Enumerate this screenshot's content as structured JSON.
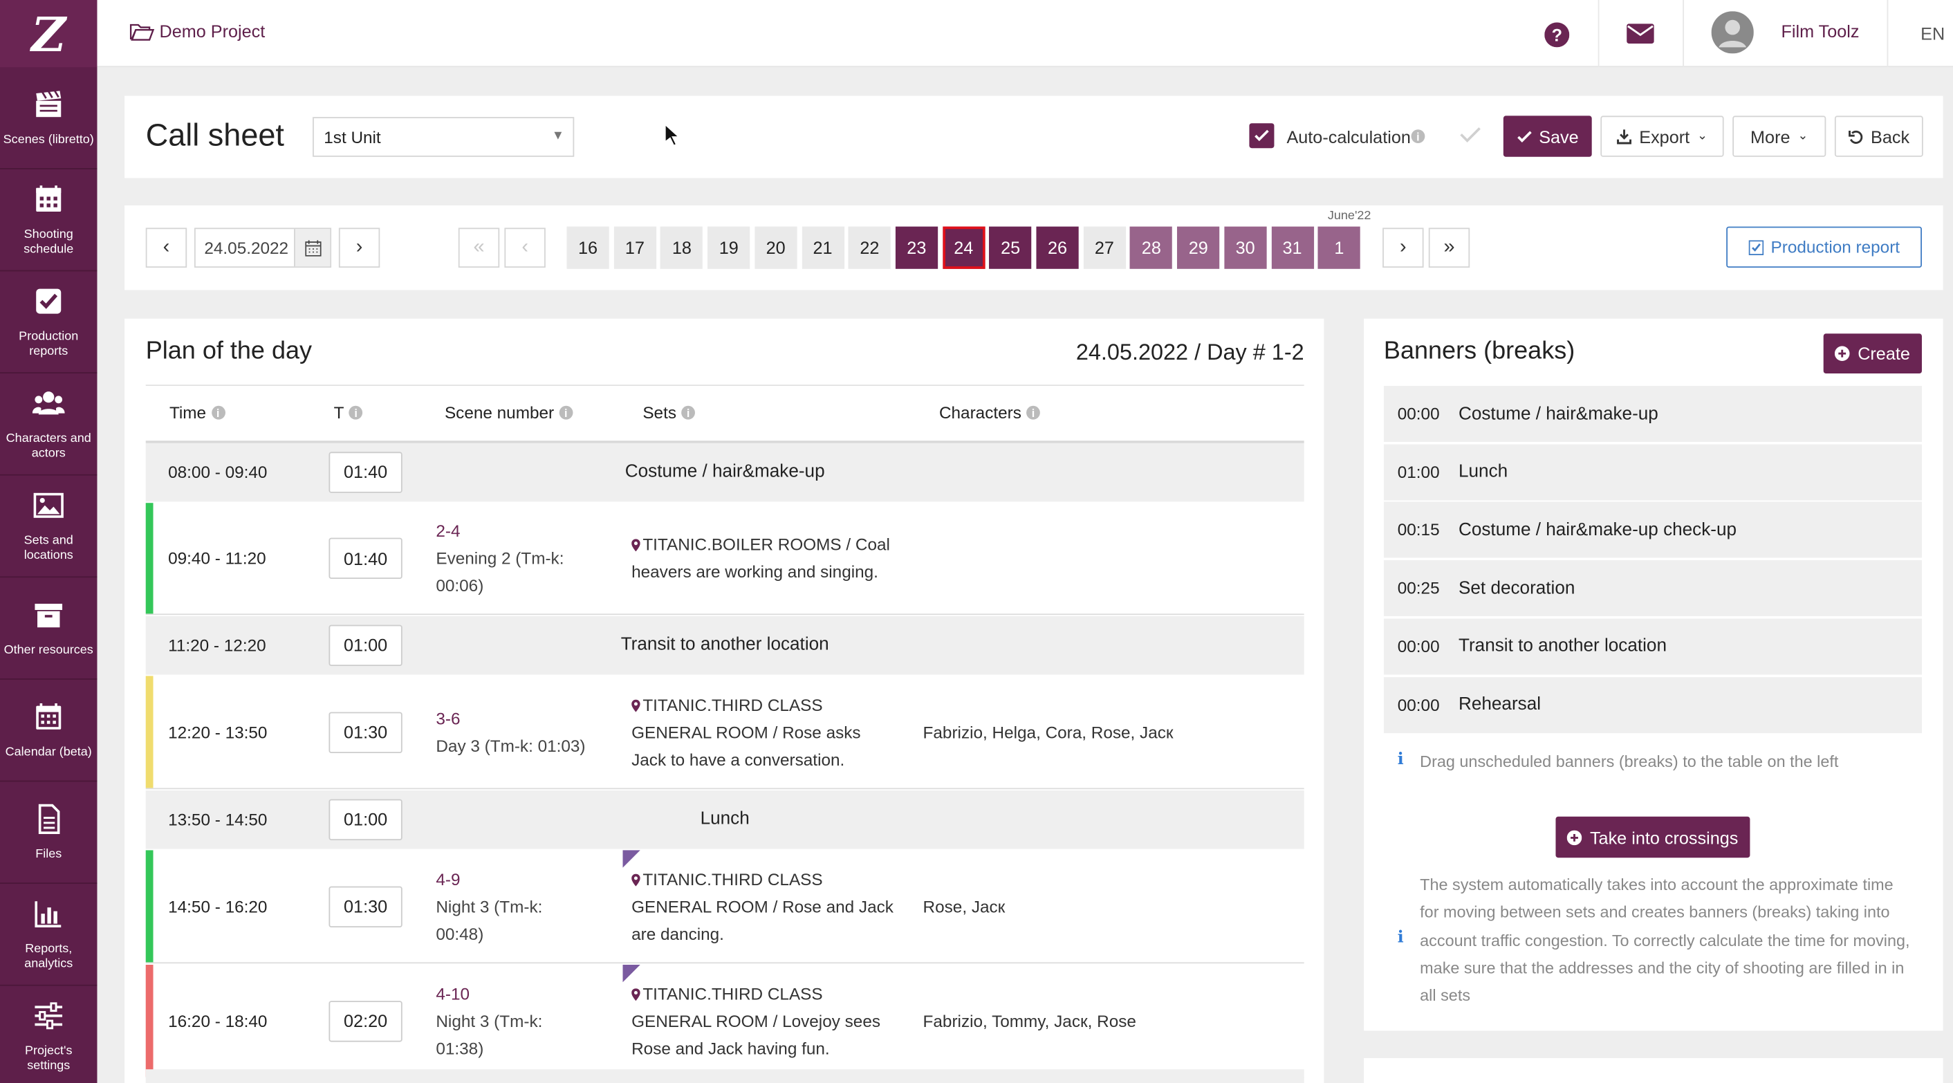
{
  "sidebar": {
    "items": [
      {
        "label": "Scenes (libretto)",
        "icon": "clapperboard-icon"
      },
      {
        "label": "Shooting schedule",
        "icon": "calendar-grid-icon"
      },
      {
        "label": "Production reports",
        "icon": "checkbox-icon"
      },
      {
        "label": "Characters and actors",
        "icon": "users-icon"
      },
      {
        "label": "Sets and locations",
        "icon": "image-icon"
      },
      {
        "label": "Other resources",
        "icon": "archive-box-icon"
      },
      {
        "label": "Calendar (beta)",
        "icon": "calendar-icon"
      },
      {
        "label": "Files",
        "icon": "file-icon"
      },
      {
        "label": "Reports, analytics",
        "icon": "bar-chart-icon"
      },
      {
        "label": "Project's settings",
        "icon": "sliders-icon"
      }
    ]
  },
  "topbar": {
    "project": "Demo Project",
    "user": "Film Toolz",
    "lang": "EN"
  },
  "header": {
    "title": "Call sheet",
    "unit": "1st Unit",
    "autocalc_label": "Auto-calculation",
    "autocalc_checked": true,
    "save": "Save",
    "export": "Export",
    "more": "More",
    "back": "Back"
  },
  "datebar": {
    "date": "24.05.2022",
    "month_label": "June'22",
    "days": [
      {
        "d": "16",
        "state": "plain"
      },
      {
        "d": "17",
        "state": "plain"
      },
      {
        "d": "18",
        "state": "plain"
      },
      {
        "d": "19",
        "state": "plain"
      },
      {
        "d": "20",
        "state": "plain"
      },
      {
        "d": "21",
        "state": "plain"
      },
      {
        "d": "22",
        "state": "plain"
      },
      {
        "d": "23",
        "state": "dark"
      },
      {
        "d": "24",
        "state": "selected"
      },
      {
        "d": "25",
        "state": "dark"
      },
      {
        "d": "26",
        "state": "dark"
      },
      {
        "d": "27",
        "state": "plain"
      },
      {
        "d": "28",
        "state": "light"
      },
      {
        "d": "29",
        "state": "light"
      },
      {
        "d": "30",
        "state": "light"
      },
      {
        "d": "31",
        "state": "light"
      },
      {
        "d": "1",
        "state": "light"
      }
    ],
    "production_report": "Production report"
  },
  "plan": {
    "title": "Plan of the day",
    "day_info": "24.05.2022 / Day # 1-2",
    "columns": {
      "time": "Time",
      "t": "T",
      "scene": "Scene number",
      "sets": "Sets",
      "characters": "Characters"
    },
    "rows": [
      {
        "time": "08:00 - 09:40",
        "dur": "01:40",
        "banner": "Costume / hair&make-up"
      },
      {
        "time": "09:40 - 11:20",
        "dur": "01:40",
        "scene_num": "2-4",
        "scene_desc": [
          "Evening 2 (Tm-k:",
          "00:06)"
        ],
        "sets": [
          "TITANIC.BOILER ROOMS / Coal",
          "heavers are working and singing."
        ],
        "characters": "",
        "color": "#34c759"
      },
      {
        "time": "11:20 - 12:20",
        "dur": "01:00",
        "banner": "Transit to another location"
      },
      {
        "time": "12:20 - 13:50",
        "dur": "01:30",
        "scene_num": "3-6",
        "scene_desc": [
          "Day 3 (Tm-k: 01:03)"
        ],
        "sets": [
          "TITANIC.THIRD CLASS",
          "GENERAL ROOM / Rose asks",
          "Jack to have a conversation."
        ],
        "characters": "Fabrizio, Helga, Cora, Rose, Jacк",
        "color": "#f0dc6e"
      },
      {
        "time": "13:50 - 14:50",
        "dur": "01:00",
        "banner": "Lunch"
      },
      {
        "time": "14:50 - 16:20",
        "dur": "01:30",
        "scene_num": "4-9",
        "scene_desc": [
          "Night 3 (Tm-k:",
          "00:48)"
        ],
        "sets": [
          "TITANIC.THIRD CLASS",
          "GENERAL ROOM / Rose and Jack",
          "are dancing."
        ],
        "characters": "Rose, Jacк",
        "color": "#34c759"
      },
      {
        "time": "16:20 - 18:40",
        "dur": "02:20",
        "scene_num": "4-10",
        "scene_desc": [
          "Night 3 (Tm-k:",
          "01:38)"
        ],
        "sets": [
          "TITANIC.THIRD CLASS",
          "GENERAL ROOM / Lovejoy sees",
          "Rose and Jack having fun."
        ],
        "characters": "Fabrizio, Tommy, Jacк, Rose",
        "color": "#ec6b6b"
      }
    ]
  },
  "banners": {
    "title": "Banners (breaks)",
    "create": "Create",
    "items": [
      {
        "time": "00:00",
        "label": "Costume / hair&make-up"
      },
      {
        "time": "01:00",
        "label": "Lunch"
      },
      {
        "time": "00:15",
        "label": "Costume / hair&make-up check-up"
      },
      {
        "time": "00:25",
        "label": "Set decoration"
      },
      {
        "time": "00:00",
        "label": "Transit to another location"
      },
      {
        "time": "00:00",
        "label": "Rehearsal"
      }
    ],
    "hint": "Drag unscheduled banners (breaks) to the table on the left",
    "take": "Take into crossings",
    "note": [
      "The system automatically takes into account the approximate time",
      "for moving between sets and creates banners (breaks) taking into",
      "account traffic congestion. To correctly calculate the time for moving,",
      "make sure that the addresses and the city of shooting are filled in in",
      "all sets"
    ]
  },
  "colors": {
    "brand": "#6a2553",
    "sidebar": "#5e1f4a",
    "selected_border": "#e0101a",
    "info_icon": "#2f7bd6"
  }
}
